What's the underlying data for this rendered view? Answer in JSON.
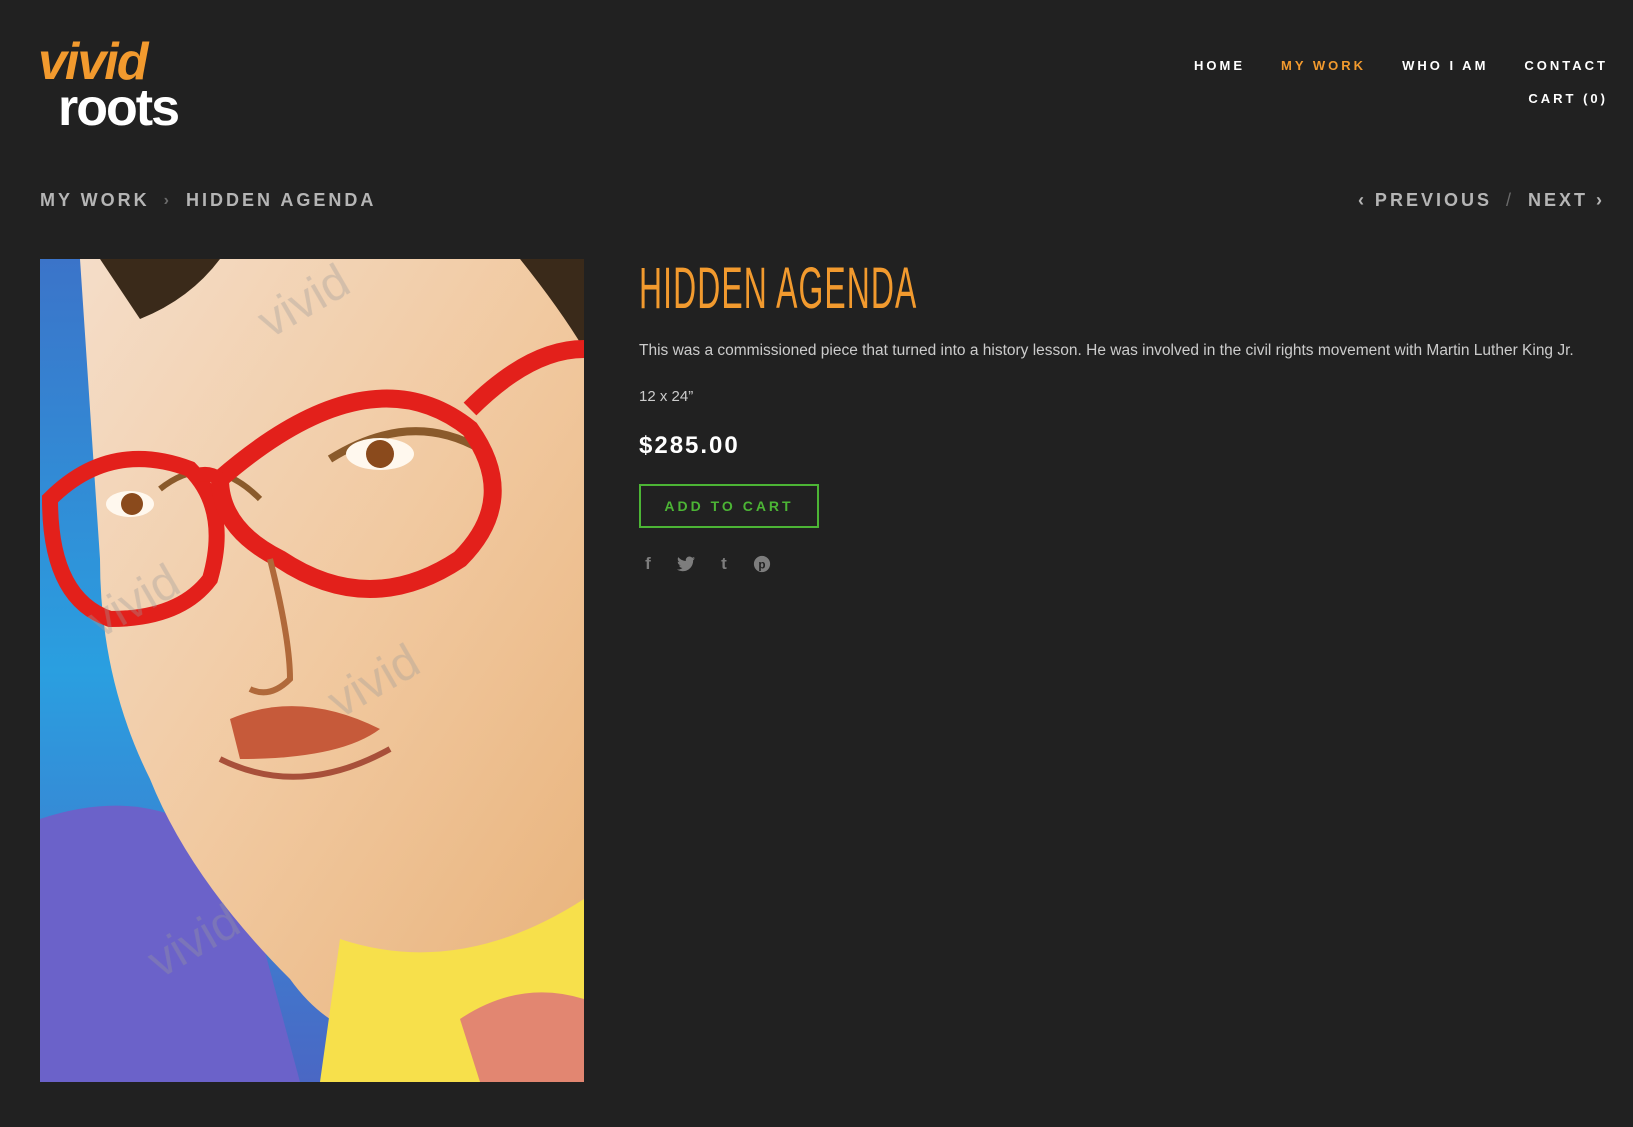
{
  "brand": {
    "logo_top": "vivid",
    "logo_bottom": "roots",
    "accent": "#f29a2e",
    "logo_bottom_color": "#ffffff"
  },
  "nav": {
    "items": [
      {
        "label": "HOME"
      },
      {
        "label": "MY WORK",
        "active": true
      },
      {
        "label": "WHO I AM"
      },
      {
        "label": "CONTACT"
      }
    ],
    "cart": "CART (0)"
  },
  "breadcrumb": {
    "parent": "MY WORK",
    "separator": "›",
    "current": "HIDDEN AGENDA"
  },
  "pager": {
    "previous": "‹ PREVIOUS",
    "separator": "/",
    "next": "NEXT ›"
  },
  "product": {
    "title": "HIDDEN AGENDA",
    "description": "This was a commissioned piece that turned into a history lesson.  He was involved in the civil rights movement with Martin Luther King Jr.",
    "dimensions": "12 x 24”",
    "price": "$285.00",
    "add_to_cart": "ADD TO CART",
    "button_color": "#4cb535"
  },
  "share_icons": [
    "facebook-icon",
    "twitter-icon",
    "tumblr-icon",
    "pinterest-icon"
  ]
}
